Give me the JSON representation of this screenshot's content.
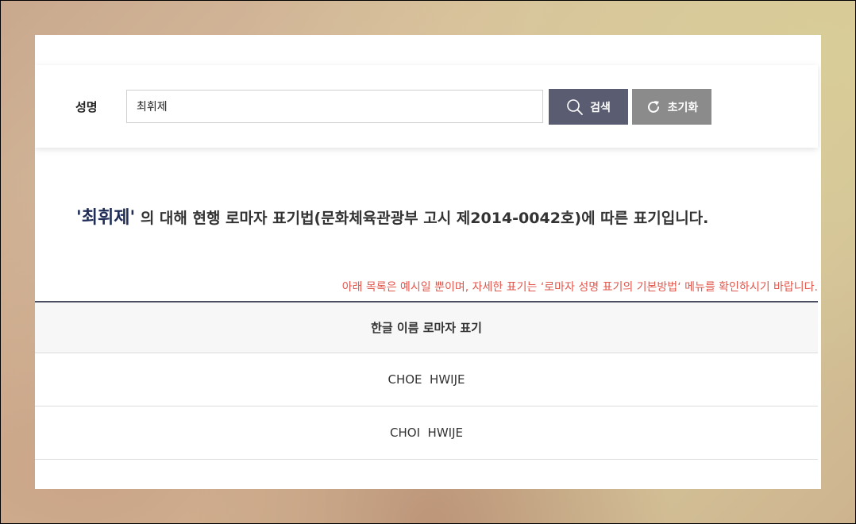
{
  "search": {
    "label": "성명",
    "value": "최휘제",
    "search_button": "검색",
    "reset_button": "초기화"
  },
  "result": {
    "name_quoted": "'최휘제'",
    "description": " 의 대해 현행 로마자 표기법(문화체육관광부 고시 제2014-0042호)에 따른 표기입니다."
  },
  "notice": "아래 목록은 예시일 뿐이며, 자세한 표기는 ‘로마자 성명 표기의 기본방법‘ 메뉴를 확인하시기 바랍니다.",
  "table": {
    "header": "한글 이름 로마자 표기",
    "rows": [
      "CHOE  HWIJE",
      "CHOI  HWIJE"
    ]
  },
  "colors": {
    "search_button": "#5a5d72",
    "reset_button": "#8a8b8a",
    "name_highlight": "#1f2d57",
    "notice": "#e2574c"
  }
}
